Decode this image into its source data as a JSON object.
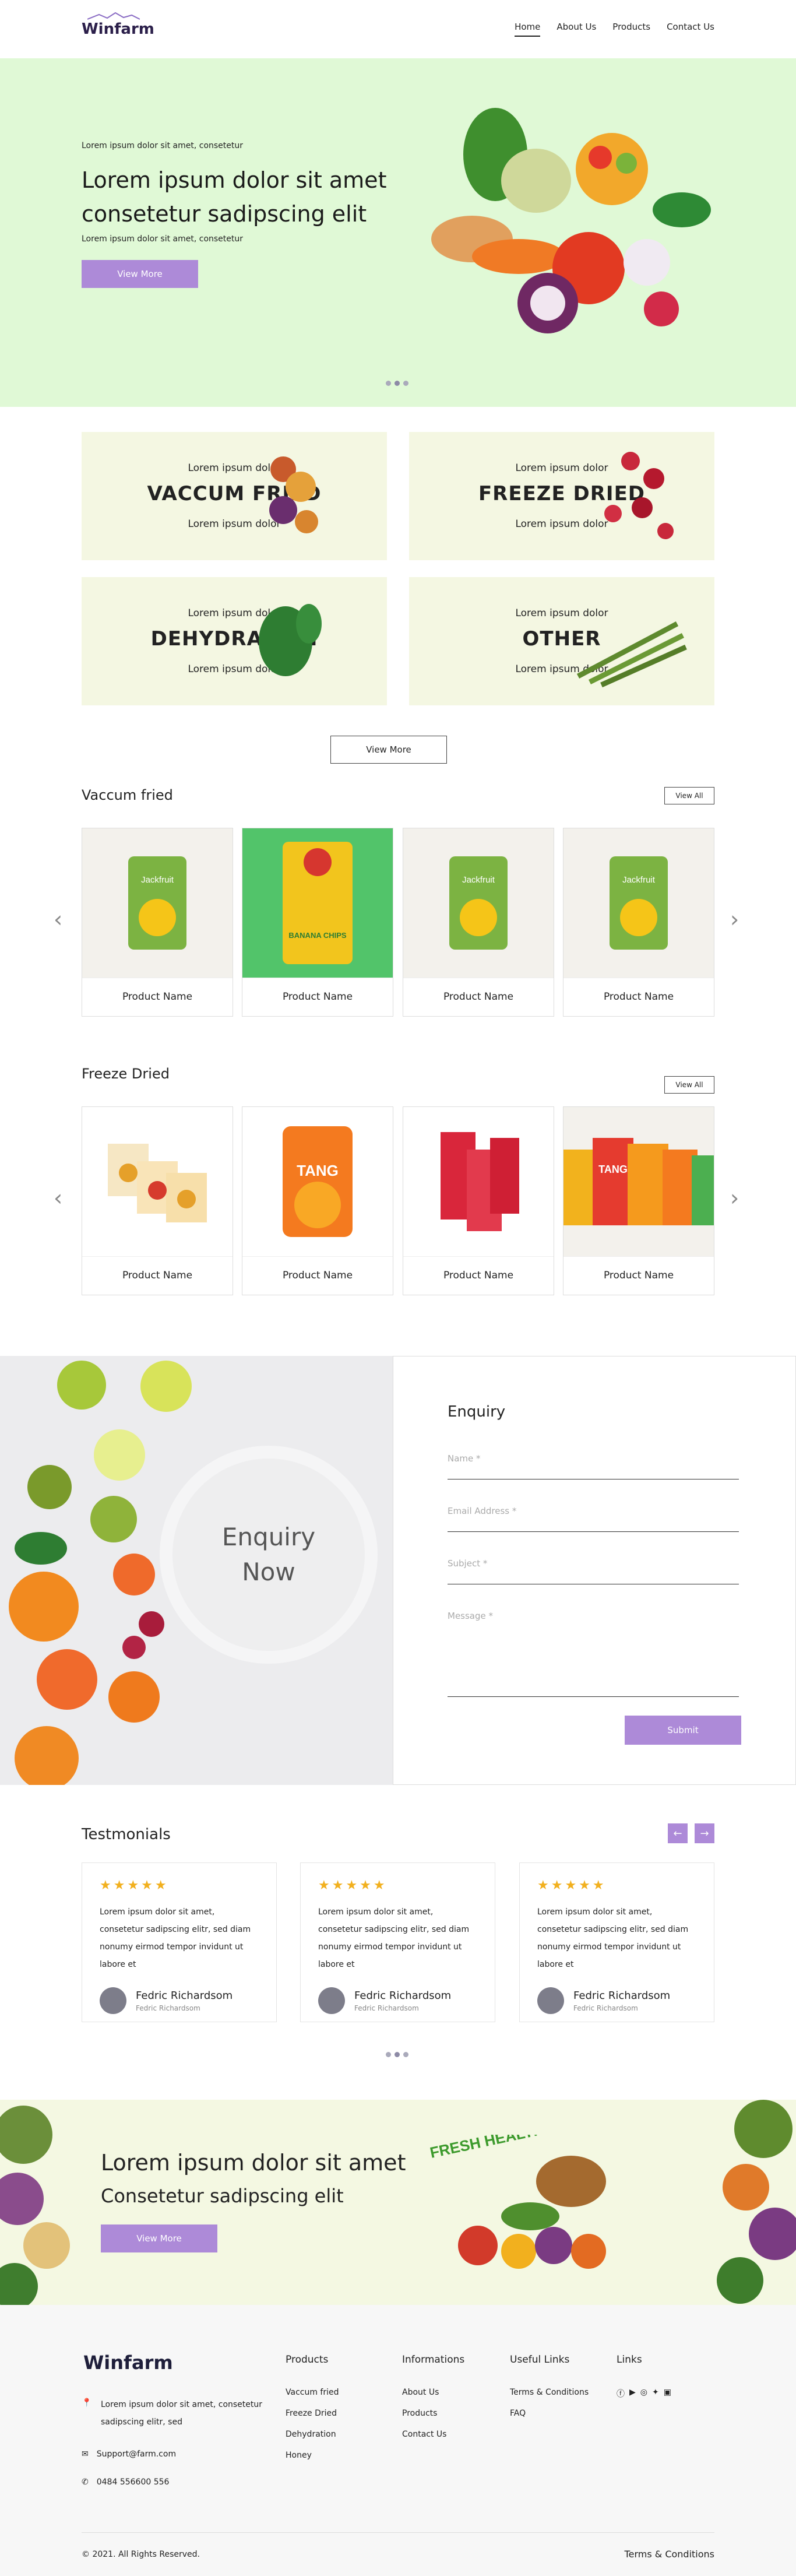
{
  "nav": {
    "logo": "Winfarm",
    "items": [
      "Home",
      "About Us",
      "Products",
      "Contact Us"
    ]
  },
  "hero": {
    "pre": "Lorem ipsum dolor sit amet, consetetur",
    "title": "Lorem ipsum dolor sit amet consetetur sadipscing elit",
    "sub": "Lorem ipsum dolor sit amet, consetetur",
    "button": "View More"
  },
  "categories": [
    {
      "top": "Lorem ipsum dolor",
      "name": "VACCUM FRIED",
      "bottom": "Lorem ipsum dolor"
    },
    {
      "top": "Lorem ipsum dolor",
      "name": "FREEZE DRIED",
      "bottom": "Lorem ipsum dolor"
    },
    {
      "top": "Lorem ipsum dolor",
      "name": "DEHYDRATION",
      "bottom": "Lorem ipsum dolor"
    },
    {
      "top": "Lorem ipsum dolor",
      "name": "OTHER",
      "bottom": "Lorem ipsum dolor"
    }
  ],
  "categories_button": "View More",
  "vaccum": {
    "title": "Vaccum fried",
    "view_all": "View All",
    "products": [
      "Product Name",
      "Product Name",
      "Product Name",
      "Product Name"
    ],
    "pack_labels": [
      "Jackfruit",
      "BANANA CHIPS",
      "Jackfruit",
      "Jackfruit"
    ]
  },
  "freeze": {
    "title": "Freeze Dried",
    "view_all": "View All",
    "products": [
      "Product Name",
      "Product Name",
      "Product Name",
      "Product Name"
    ],
    "pack_labels": [
      "",
      "TANG",
      "",
      "TANG"
    ]
  },
  "enquiry": {
    "circle_line1": "Enquiry",
    "circle_line2": "Now",
    "title": "Enquiry",
    "name_placeholder": "Name *",
    "email_placeholder": "Email Address *",
    "subject_placeholder": "Subject *",
    "message_placeholder": "Message *",
    "submit": "Submit"
  },
  "testimonials": {
    "title": "Testmonials",
    "prev": "←",
    "next": "→",
    "items": [
      {
        "stars": "★★★★★",
        "text": "Lorem ipsum dolor sit amet, consetetur sadipscing elitr, sed diam nonumy eirmod tempor invidunt ut labore et",
        "name": "Fedric Richardsom",
        "role": "Fedric Richardsom"
      },
      {
        "stars": "★★★★★",
        "text": "Lorem ipsum dolor sit amet, consetetur sadipscing elitr, sed diam nonumy eirmod tempor invidunt ut labore et",
        "name": "Fedric Richardsom",
        "role": "Fedric Richardsom"
      },
      {
        "stars": "★★★★★",
        "text": "Lorem ipsum dolor sit amet, consetetur sadipscing elitr, sed diam nonumy eirmod tempor invidunt ut labore et",
        "name": "Fedric Richardsom",
        "role": "Fedric Richardsom"
      }
    ]
  },
  "banner": {
    "title": "Lorem ipsum dolor sit amet",
    "sub": "Consetetur sadipscing elit",
    "button": "View More",
    "badge": "FRESH HEALTHY VEGETABLES"
  },
  "footer": {
    "logo": "Winfarm",
    "address": "Lorem ipsum dolor sit amet, consetetur sadipscing elitr, sed",
    "email": "Support@farm.com",
    "phone": "0484 556600 556",
    "products_title": "Products",
    "products": [
      "Vaccum fried",
      "Freeze Dried",
      "Dehydration",
      "Honey"
    ],
    "info_title": "Informations",
    "info": [
      "About Us",
      "Products",
      "Contact Us"
    ],
    "useful_title": "Useful Links",
    "useful": [
      "Terms & Conditions",
      "FAQ"
    ],
    "links_title": "Links",
    "copyright": "© 2021. All Rights Reserved.",
    "terms": "Terms & Conditions"
  },
  "colors": {
    "accent": "#ad8ad8",
    "hero_bg": "#e0f9d6",
    "star": "#f2b01e"
  }
}
